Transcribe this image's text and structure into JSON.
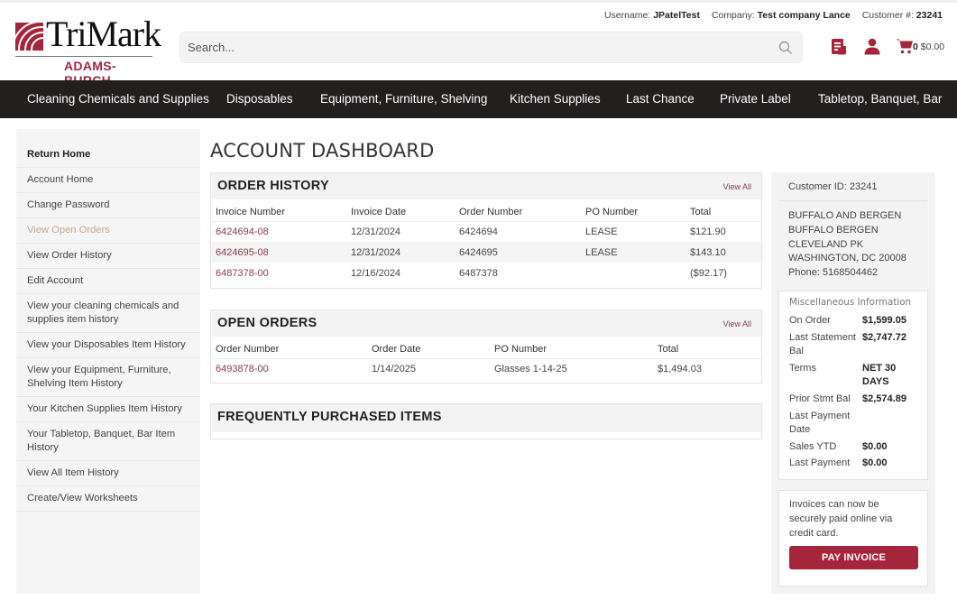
{
  "brand": {
    "name": "TriMark",
    "sub": "ADAMS-BURCH",
    "accent_color": "#a5253b"
  },
  "userinfo": {
    "username_label": "Username:",
    "username": "JPatelTest",
    "company_label": "Company:",
    "company": "Test company Lance",
    "customer_label": "Customer #:",
    "customer": "23241"
  },
  "search": {
    "placeholder": "Search...",
    "value": ""
  },
  "header_icons": [
    "invoices-icon",
    "user-icon",
    "cart-icon"
  ],
  "cart": {
    "count": "0",
    "total": "$0.00"
  },
  "nav": [
    "Cleaning Chemicals and Supplies",
    "Disposables",
    "Equipment, Furniture, Shelving",
    "Kitchen Supplies",
    "Last Chance",
    "Private Label",
    "Tabletop, Banquet, Bar"
  ],
  "sidebar": {
    "items": [
      {
        "label": "Return Home"
      },
      {
        "label": "Account Home"
      },
      {
        "label": "Change Password"
      },
      {
        "label": "View Open Orders",
        "active": true
      },
      {
        "label": "View Order History"
      },
      {
        "label": "Edit Account"
      },
      {
        "label": "View your cleaning chemicals and supplies item history"
      },
      {
        "label": "View your Disposables Item History"
      },
      {
        "label": "View your Equipment, Furniture, Shelving Item History"
      },
      {
        "label": "Your Kitchen Supplies Item History"
      },
      {
        "label": "Your Tabletop, Banquet, Bar Item History"
      },
      {
        "label": "View All Item History"
      },
      {
        "label": "Create/View Worksheets"
      }
    ]
  },
  "page_title": "ACCOUNT DASHBOARD",
  "order_history": {
    "title": "ORDER HISTORY",
    "view_all": "View All",
    "columns": [
      "Invoice Number",
      "Invoice Date",
      "Order Number",
      "PO Number",
      "Total"
    ],
    "rows": [
      [
        "6424694-08",
        "12/31/2024",
        "6424694",
        "LEASE",
        "$121.90"
      ],
      [
        "6424695-08",
        "12/31/2024",
        "6424695",
        "LEASE",
        "$143.10"
      ],
      [
        "6487378-00",
        "12/16/2024",
        "6487378",
        "",
        "($92.17)"
      ]
    ]
  },
  "open_orders": {
    "title": "OPEN ORDERS",
    "view_all": "View All",
    "columns": [
      "Order Number",
      "Order Date",
      "PO Number",
      "Total"
    ],
    "rows": [
      [
        "6493878-00",
        "1/14/2025",
        "Glasses 1-14-25",
        "$1,494.03"
      ]
    ]
  },
  "frequently_purchased": {
    "title": "FREQUENTLY PURCHASED ITEMS"
  },
  "customer": {
    "id_line": "Customer ID: 23241",
    "address": [
      "BUFFALO AND BERGEN",
      "BUFFALO BERGEN",
      "CLEVELAND PK",
      "WASHINGTON, DC 20008",
      "Phone: 5168504462"
    ]
  },
  "misc": {
    "title": "Miscellaneous Information",
    "rows": [
      {
        "k": "On Order",
        "v": "$1,599.05"
      },
      {
        "k": "Last Statement Bal",
        "v": "$2,747.72"
      },
      {
        "k": "Terms",
        "v": "NET 30 DAYS"
      },
      {
        "k": "Prior Stmt Bal",
        "v": "$2,574.89"
      },
      {
        "k": "Last Payment Date",
        "v": ""
      },
      {
        "k": "Sales YTD",
        "v": "$0.00"
      },
      {
        "k": "Last Payment",
        "v": "$0.00"
      }
    ]
  },
  "pay": {
    "text": "Invoices can now be securely paid online via credit card.",
    "button": "PAY INVOICE"
  }
}
